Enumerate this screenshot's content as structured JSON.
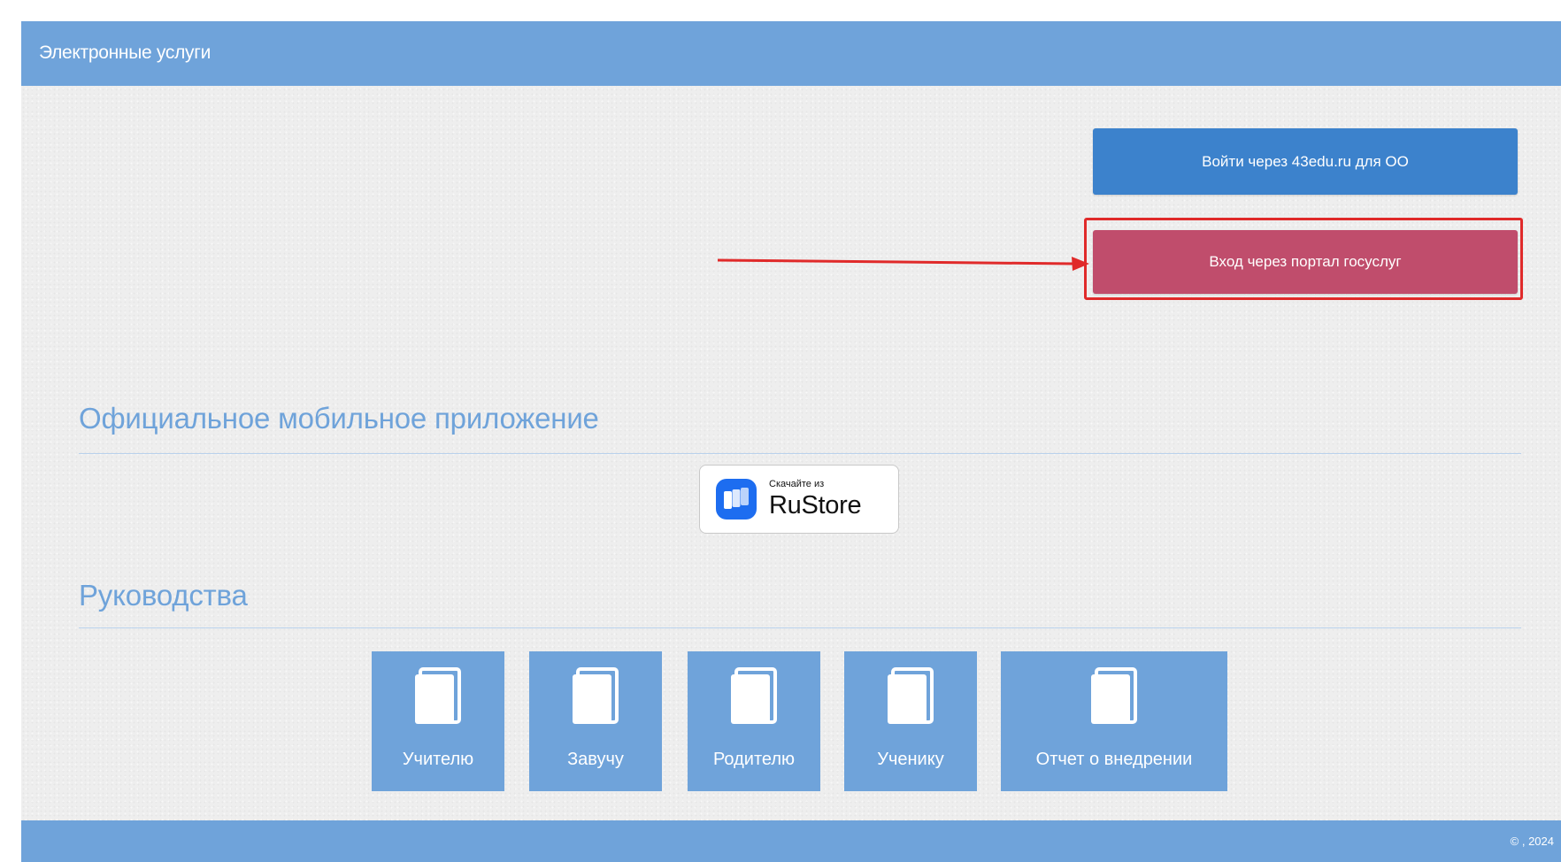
{
  "header": {
    "title": "Электронные услуги"
  },
  "auth": {
    "edu_button": "Войти через 43edu.ru для ОО",
    "gosuslugi_button": "Вход через портал госуслуг"
  },
  "mobile": {
    "section_title": "Официальное мобильное приложение",
    "rustore_small": "Скачайте из",
    "rustore_big": "RuStore"
  },
  "guides": {
    "section_title": "Руководства",
    "items": [
      {
        "label": "Учителю"
      },
      {
        "label": "Завучу"
      },
      {
        "label": "Родителю"
      },
      {
        "label": "Ученику"
      },
      {
        "label": "Отчет о внедрении"
      }
    ]
  },
  "footer": {
    "text": "© , 2024"
  },
  "colors": {
    "header_blue": "#6fa3da",
    "edu_button": "#3c82cc",
    "gosuslugi_button": "#c04d6c",
    "annotation_red": "#e02a2a",
    "rustore_blue": "#1d6df0"
  },
  "icons": {
    "guide_tile": "document-icon",
    "rustore": "rustore-logo-icon",
    "annotation": "arrow-right-icon"
  }
}
